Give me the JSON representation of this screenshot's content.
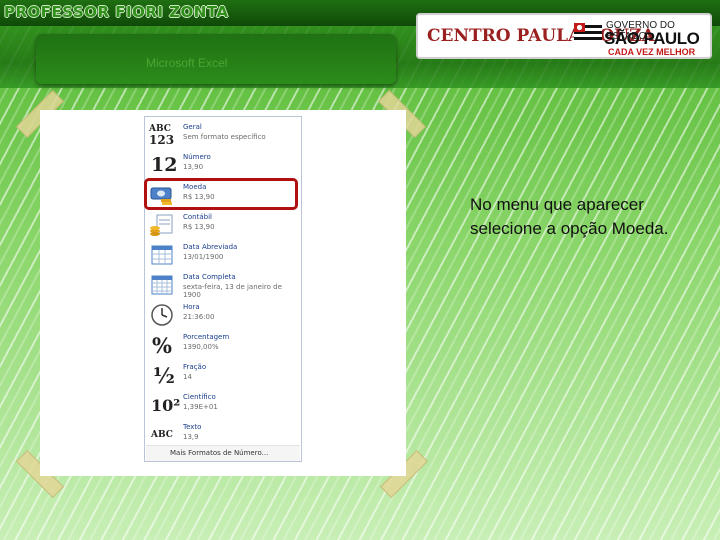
{
  "header": {
    "brand": "PROFESSOR FIORI ZONTA",
    "subtitle": "Microsoft Excel",
    "institution": "CENTRO PAULA SOUZA",
    "state_line1": "GOVERNO DO ESTADO",
    "state_line2": "SÃO PAULO",
    "state_line3": "CADA VEZ MELHOR"
  },
  "menu": {
    "items": [
      {
        "name": "Geral",
        "sample": "Sem formato específico",
        "icon": "abc-123-icon",
        "glyph": "ABC\n123"
      },
      {
        "name": "Número",
        "sample": "13,90",
        "icon": "number-12-icon",
        "glyph": "12"
      },
      {
        "name": "Moeda",
        "sample": "R$ 13,90",
        "icon": "currency-icon",
        "glyph": ""
      },
      {
        "name": "Contábil",
        "sample": " R$ 13,90",
        "icon": "accounting-icon",
        "glyph": ""
      },
      {
        "name": "Data Abreviada",
        "sample": "13/01/1900",
        "icon": "calendar-short-icon",
        "glyph": ""
      },
      {
        "name": "Data Completa",
        "sample": "sexta-feira, 13 de janeiro de 1900",
        "icon": "calendar-long-icon",
        "glyph": ""
      },
      {
        "name": "Hora",
        "sample": "21:36:00",
        "icon": "clock-icon",
        "glyph": ""
      },
      {
        "name": "Porcentagem",
        "sample": "1390,00%",
        "icon": "percent-icon",
        "glyph": "%"
      },
      {
        "name": "Fração",
        "sample": "14",
        "icon": "fraction-icon",
        "glyph": "½"
      },
      {
        "name": "Científico",
        "sample": "1,39E+01",
        "icon": "scientific-icon",
        "glyph": "10²"
      },
      {
        "name": "Texto",
        "sample": "13,9",
        "icon": "text-abc-icon",
        "glyph": "ABC"
      }
    ],
    "footer": "Mais Formatos de Número...",
    "selected": "Moeda"
  },
  "description": "No menu que aparecer selecione a opção Moeda.",
  "colors": {
    "highlight": "#b01010",
    "item_name": "#1a3e8c",
    "background_green": "#5fc23a"
  }
}
